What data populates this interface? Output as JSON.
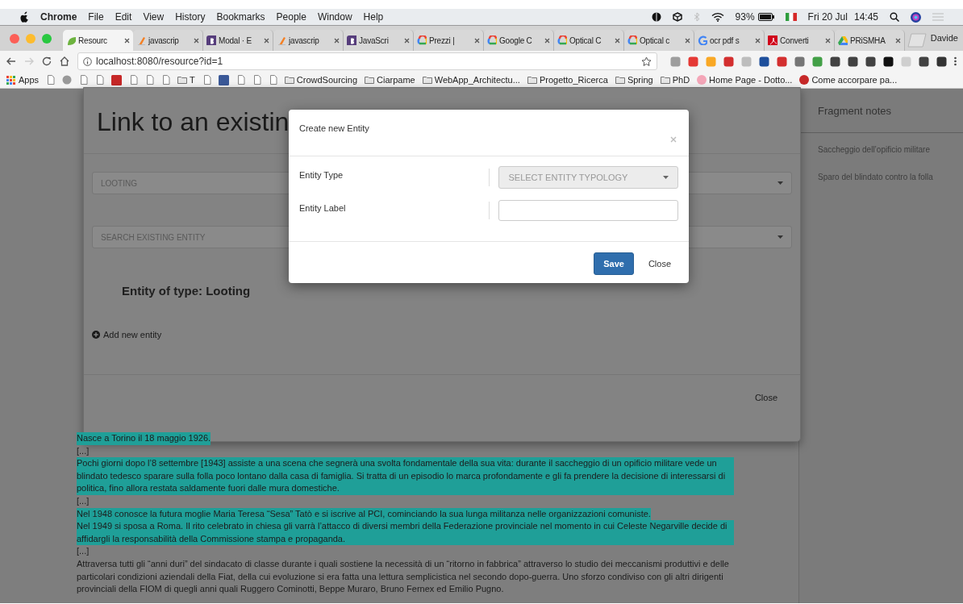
{
  "menu_bar": {
    "app": "Chrome",
    "menus": [
      "File",
      "Edit",
      "View",
      "History",
      "Bookmarks",
      "People",
      "Window",
      "Help"
    ],
    "battery": "93%",
    "date": "Fri 20 Jul",
    "time": "14:45"
  },
  "tabs": [
    {
      "label": "Resourc",
      "kind": "leaf",
      "selected": true
    },
    {
      "label": "javascrip",
      "kind": "stack",
      "selected": false
    },
    {
      "label": "Modal · E",
      "kind": "bootstrap",
      "selected": false
    },
    {
      "label": "javascrip",
      "kind": "stack",
      "selected": false
    },
    {
      "label": "JavaScri",
      "kind": "bootstrap",
      "selected": false
    },
    {
      "label": "Prezzi |",
      "kind": "cloud",
      "selected": false
    },
    {
      "label": "Google C",
      "kind": "cloud",
      "selected": false
    },
    {
      "label": "Optical C",
      "kind": "cloud",
      "selected": false
    },
    {
      "label": "Optical c",
      "kind": "cloud",
      "selected": false
    },
    {
      "label": "ocr pdf s",
      "kind": "google",
      "selected": false
    },
    {
      "label": "Converti",
      "kind": "pdf",
      "selected": false
    },
    {
      "label": "PRiSMHA",
      "kind": "drive",
      "selected": false
    }
  ],
  "profile": "Davide",
  "address_bar": {
    "url": "localhost:8080/resource?id=1"
  },
  "bookmarks": [
    {
      "kind": "apps",
      "label": "Apps"
    },
    {
      "kind": "page"
    },
    {
      "kind": "globe"
    },
    {
      "kind": "page"
    },
    {
      "kind": "page"
    },
    {
      "kind": "logo",
      "color": "#c62828"
    },
    {
      "kind": "page"
    },
    {
      "kind": "page"
    },
    {
      "kind": "page"
    },
    {
      "kind": "folder",
      "label": "T"
    },
    {
      "kind": "page"
    },
    {
      "kind": "logo",
      "color": "#3b5998"
    },
    {
      "kind": "page"
    },
    {
      "kind": "page"
    },
    {
      "kind": "page"
    },
    {
      "kind": "folder",
      "label": "CrowdSourcing"
    },
    {
      "kind": "folder",
      "label": "Ciarpame"
    },
    {
      "kind": "folder",
      "label": "WebApp_Architectu..."
    },
    {
      "kind": "folder",
      "label": "Progetto_Ricerca"
    },
    {
      "kind": "folder",
      "label": "Spring"
    },
    {
      "kind": "folder",
      "label": "PhD"
    },
    {
      "kind": "site",
      "label": "Home Page - Dotto...",
      "color": "#f4a6b8"
    },
    {
      "kind": "site",
      "label": "Come accorpare pa...",
      "color": "#c62828"
    }
  ],
  "background_dialog": {
    "title": "Link to an existin",
    "type_select": "LOOTING",
    "search_select": "SEARCH EXISTING ENTITY",
    "heading": "Entity of type: Looting",
    "add_link": "Add new entity",
    "close": "Close"
  },
  "dialog": {
    "title": "Create new Entity",
    "fields": [
      {
        "label": "Entity Type",
        "kind": "select",
        "placeholder": "SELECT ENTITY TYPOLOGY"
      },
      {
        "label": "Entity Label",
        "kind": "text"
      }
    ],
    "buttons": [
      {
        "label": "Save",
        "kind": "primary"
      },
      {
        "label": "Close",
        "kind": "plain"
      }
    ]
  },
  "fragment_text": [
    {
      "text": "Nasce a Torino il 18 maggio 1926.",
      "highlighted": true
    },
    {
      "text": "[...]",
      "highlighted": false
    },
    {
      "text": "Pochi giorni dopo l’8 settembre [1943] assiste a una scena che segnerà una svolta fondamentale della sua vita: durante il saccheggio di un opificio militare vede un blindato tedesco sparare sulla folla poco lontano dalla casa di famiglia. Si tratta di un episodio lo marca profondamente e gli fa prendere la decisione di interessarsi di politica, fino allora restata saldamente fuori dalle mura domestiche.",
      "highlighted": true
    },
    {
      "text": "[...]",
      "highlighted": false
    },
    {
      "text": "Nel 1948 conosce la futura moglie Maria Teresa “Sesa” Tatò e si iscrive al PCI, cominciando la sua lunga militanza nelle organizzazioni comuniste.",
      "highlighted": true
    },
    {
      "text": "Nel 1949 si sposa a Roma. Il rito celebrato in chiesa gli varrà l’attacco di diversi membri della Federazione provinciale nel momento in cui Celeste Negarville decide di affidargli la responsabilità della Commissione stampa e propaganda.",
      "highlighted": true
    },
    {
      "text": "[...]",
      "highlighted": false
    },
    {
      "text": "Attraversa tutti gli “anni duri” del sindacato di classe durante i quali sostiene la necessità di un “ritorno in fabbrica” attraverso lo studio dei meccanismi produttivi e delle particolari condizioni aziendali della Fiat, della cui evoluzione si era fatta una lettura semplicistica nel secondo dopo-guerra. Uno sforzo condiviso con gli altri dirigenti provinciali della FIOM di quegli anni quali Ruggero Cominotti, Beppe Muraro, Bruno Fernex ed Emilio Pugno.",
      "highlighted": false
    }
  ],
  "sidebar": {
    "title": "Fragment notes",
    "notes": [
      "Saccheggio dell’opificio militare",
      "Sparo del blindato contro la folla"
    ]
  }
}
